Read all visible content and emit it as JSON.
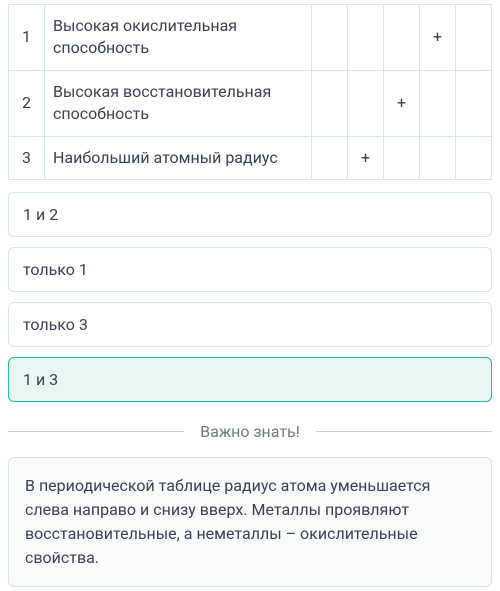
{
  "table": {
    "rows": [
      {
        "num": "1",
        "property": "Высокая окислительная способность",
        "marks": [
          "",
          "",
          "",
          "+",
          ""
        ]
      },
      {
        "num": "2",
        "property": "Высокая восстановительная способность",
        "marks": [
          "",
          "",
          "+",
          "",
          ""
        ]
      },
      {
        "num": "3",
        "property": "Наибольший атомный радиус",
        "marks": [
          "",
          "+",
          "",
          "",
          ""
        ]
      }
    ]
  },
  "options": [
    {
      "label": "1 и 2",
      "selected": false
    },
    {
      "label": "только 1",
      "selected": false
    },
    {
      "label": "только 3",
      "selected": false
    },
    {
      "label": "1 и 3",
      "selected": true
    }
  ],
  "divider_label": "Важно знать!",
  "info_text": "В периодической таблице радиус атома уменьшается слева направо и снизу вверх. Металлы проявляют восстановительные, а неметаллы – окислительные свойства."
}
